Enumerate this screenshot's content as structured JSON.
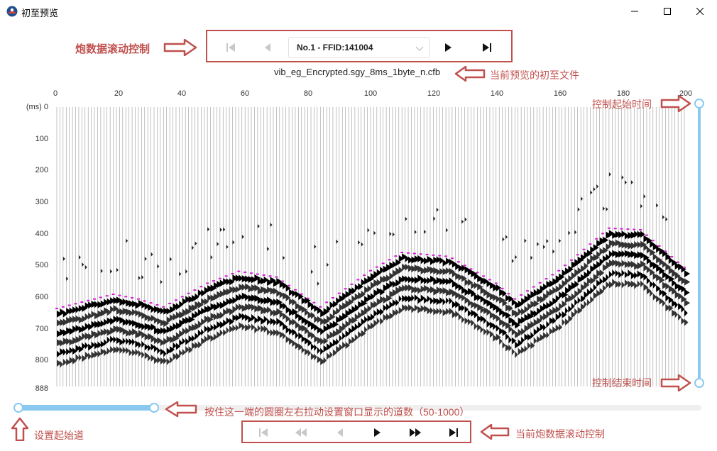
{
  "window": {
    "title": "初至预览",
    "minimize_icon": "minimize-icon",
    "maximize_icon": "maximize-icon",
    "close_icon": "close-icon"
  },
  "shot_nav": {
    "selected": "No.1 - FFID:141004",
    "buttons": [
      "first-icon",
      "prev-icon",
      "next-icon",
      "last-icon"
    ]
  },
  "file_name": "vib_eg_Encrypted.sgy_8ms_1byte_n.cfb",
  "annotations": {
    "shot_scroll": "炮数据滚动控制",
    "file_label": "当前预览的初至文件",
    "start_time": "控制起始时间",
    "end_time": "控制结束时间",
    "drag_hint": "按住这一端的圆圈左右拉动设置窗口显示的道数（50-1000）",
    "start_trace": "设置起始道",
    "current_shot_scroll": "当前炮数据滚动控制"
  },
  "axis": {
    "x_ticks": [
      "0",
      "20",
      "40",
      "60",
      "80",
      "100",
      "120",
      "140",
      "160",
      "180",
      "200"
    ],
    "y_unit": "(ms)",
    "y_ticks": [
      "0",
      "100",
      "200",
      "300",
      "400",
      "500",
      "600",
      "700",
      "800",
      "888"
    ]
  },
  "time_slider": {
    "start_ms": 0,
    "end_ms": 888
  },
  "trace_slider": {
    "start_trace": 0,
    "window_traces": 200,
    "max_traces": 1000
  },
  "colors": {
    "annotation": "#c0504d",
    "slider": "#89c9ef",
    "first_break": "#d21ed2",
    "wiggle": "#000000"
  },
  "bottom_nav": {
    "buttons": [
      "first-icon",
      "fast-back-icon",
      "prev-icon",
      "play-icon",
      "fast-forward-icon",
      "last-icon"
    ]
  }
}
